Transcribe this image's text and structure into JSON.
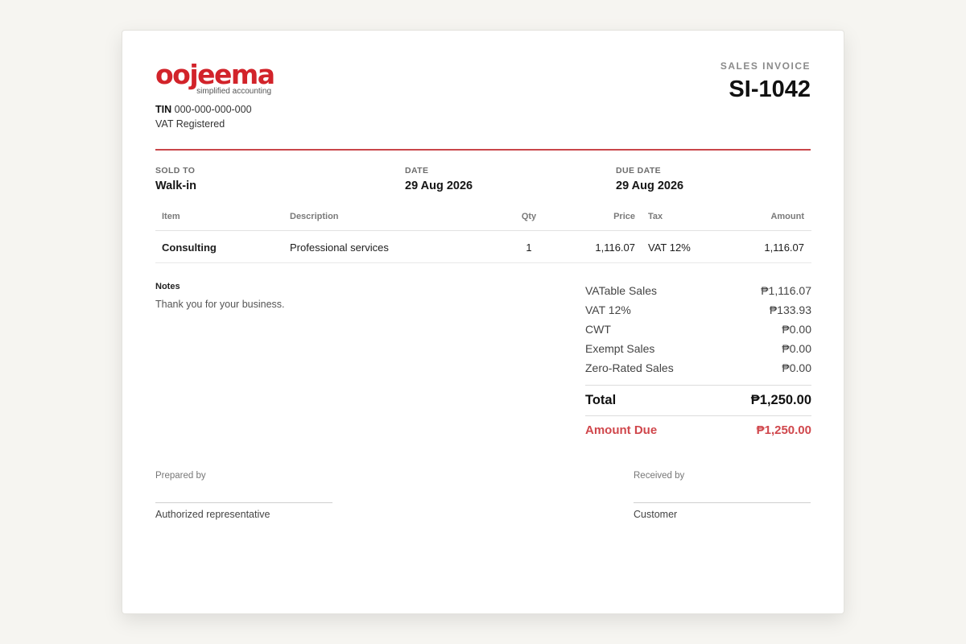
{
  "company": {
    "logo_text": "oojeema",
    "logo_tagline": "simplified accounting",
    "tin_label": "TIN",
    "tin_value": "000-000-000-000",
    "vat_status": "VAT Registered",
    "brand_color": "#d2232a"
  },
  "document": {
    "type": "SALES INVOICE",
    "number": "SI-1042"
  },
  "meta": {
    "sold_to_label": "SOLD TO",
    "sold_to_value": "Walk-in",
    "date_label": "DATE",
    "date_value": "29 Aug 2026",
    "due_date_label": "DUE DATE",
    "due_date_value": "29 Aug 2026"
  },
  "table": {
    "headers": {
      "item": "Item",
      "description": "Description",
      "qty": "Qty",
      "price": "Price",
      "tax": "Tax",
      "amount": "Amount"
    },
    "rows": [
      {
        "item": "Consulting",
        "description": "Professional services",
        "qty": "1",
        "price": "1,116.07",
        "tax": "VAT 12%",
        "amount": "1,116.07"
      }
    ]
  },
  "notes": {
    "label": "Notes",
    "text": "Thank you for your business."
  },
  "summary": {
    "lines": [
      {
        "label": "VATable Sales",
        "value": "₱1,116.07"
      },
      {
        "label": "VAT 12%",
        "value": "₱133.93"
      },
      {
        "label": "CWT",
        "value": "₱0.00"
      },
      {
        "label": "Exempt Sales",
        "value": "₱0.00"
      },
      {
        "label": "Zero-Rated Sales",
        "value": "₱0.00"
      }
    ],
    "total_label": "Total",
    "total_value": "₱1,250.00",
    "amount_due_label": "Amount Due",
    "amount_due_value": "₱1,250.00",
    "accent_color": "#d0474c"
  },
  "signatures": {
    "prepared_by_label": "Prepared by",
    "prepared_by_caption": "Authorized representative",
    "received_by_label": "Received by",
    "received_by_caption": "Customer"
  }
}
